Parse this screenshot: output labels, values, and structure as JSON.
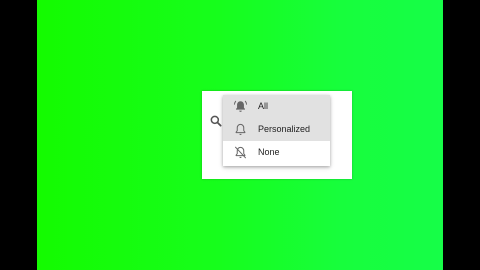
{
  "background": {
    "letterbox_color": "#000000",
    "screen_color": "#16fe2a"
  },
  "search": {
    "icon": "search-icon"
  },
  "notification_menu": {
    "selected": "All",
    "items": [
      {
        "label": "All",
        "icon": "bell-ringing-icon"
      },
      {
        "label": "Personalized",
        "icon": "bell-outline-icon"
      },
      {
        "label": "None",
        "icon": "bell-off-icon"
      }
    ]
  }
}
